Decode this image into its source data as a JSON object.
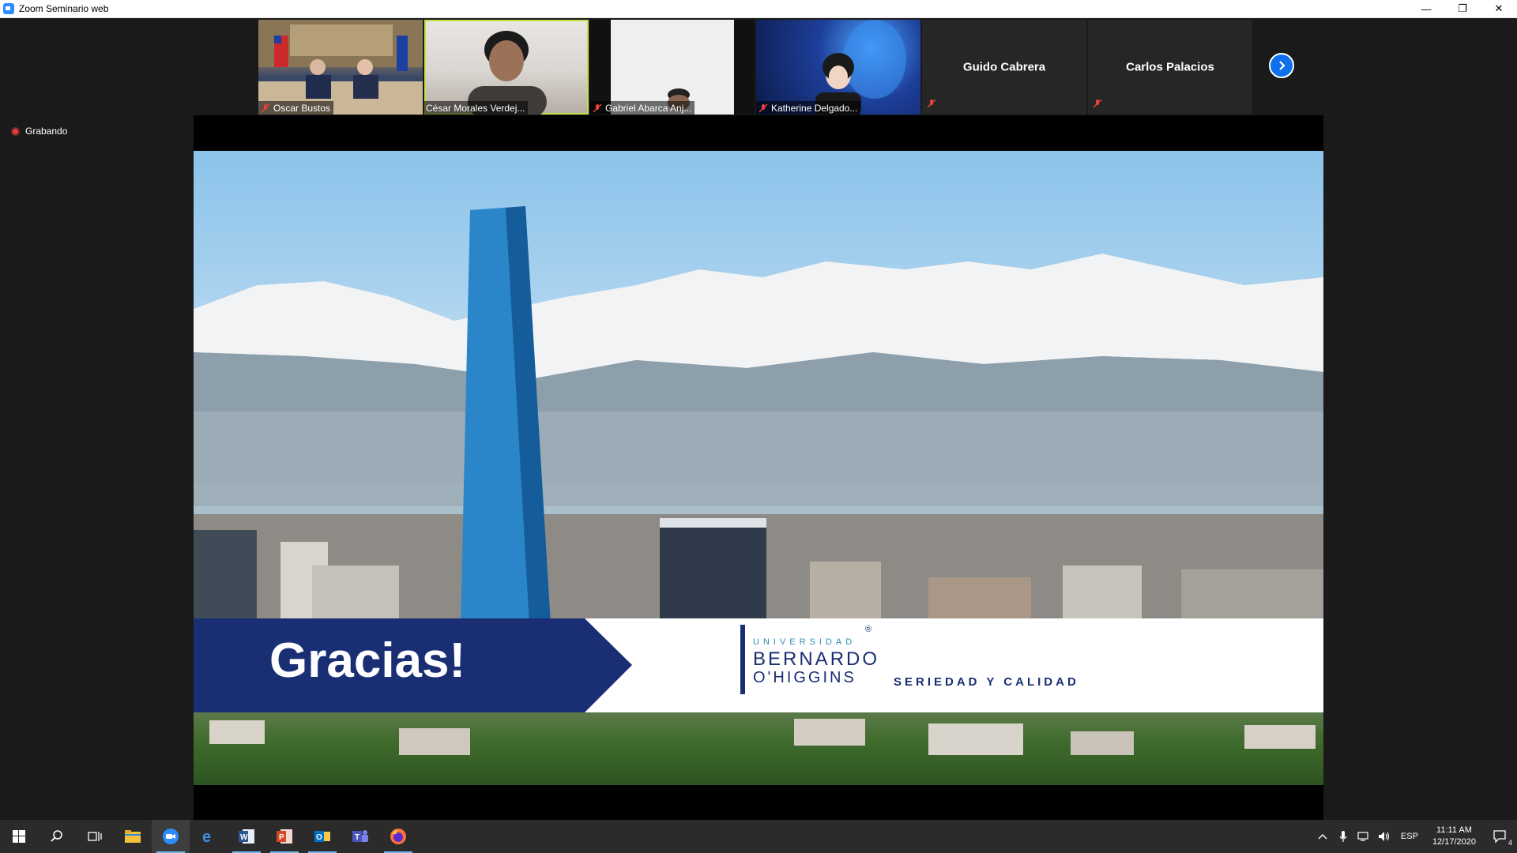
{
  "window": {
    "title": "Zoom Seminario web",
    "minimize": "—",
    "restore": "❐",
    "close": "✕"
  },
  "participants": [
    {
      "name": "Oscar Bustos",
      "muted": true,
      "has_video": true
    },
    {
      "name": "César Morales Verdej...",
      "muted": false,
      "has_video": true,
      "active_speaker": true
    },
    {
      "name": "Gabriel Abarca Anj...",
      "muted": true,
      "has_video": true
    },
    {
      "name": "Katherine Delgado...",
      "muted": true,
      "has_video": true
    },
    {
      "name": "Guido Cabrera",
      "muted": true,
      "has_video": false
    },
    {
      "name": "Carlos Palacios",
      "muted": true,
      "has_video": false
    }
  ],
  "recording": {
    "label": "Grabando"
  },
  "slide": {
    "headline": "Gracias!",
    "logo_small": "UNIVERSIDAD",
    "logo_line1": "BERNARDO",
    "logo_line2": "O'HIGGINS",
    "logo_reg": "®",
    "tagline": "SERIEDAD Y CALIDAD"
  },
  "taskbar": {
    "apps": [
      "start",
      "search",
      "task-view",
      "file-explorer",
      "zoom",
      "edge",
      "word",
      "powerpoint",
      "outlook",
      "teams",
      "firefox"
    ],
    "language": "ESP",
    "time": "11:11 AM",
    "date": "12/17/2020",
    "notifications": "4"
  },
  "colors": {
    "accent": "#0e71eb",
    "active_speaker": "#c8e04a",
    "brand_navy": "#1a2e74",
    "muted_red": "#e8403a"
  }
}
